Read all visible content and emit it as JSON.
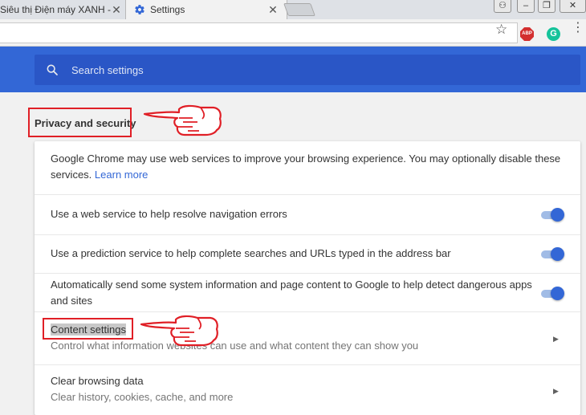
{
  "tabs": [
    {
      "title": "Siêu thị Điện máy XANH - M",
      "close": "✕"
    },
    {
      "title": "Settings",
      "close": "✕"
    }
  ],
  "window_controls": [
    "⚇",
    "–",
    "❐",
    "✕"
  ],
  "toolbar": {
    "star": "☆",
    "abp": "ABP",
    "grammarly": "G",
    "menu": "⋮"
  },
  "search": {
    "placeholder": "Search settings"
  },
  "section": {
    "title": "Privacy and security"
  },
  "intro": {
    "text": "Google Chrome may use web services to improve your browsing experience. You may optionally disable these services.",
    "link": "Learn more"
  },
  "settings": [
    {
      "label": "Use a web service to help resolve navigation errors",
      "enabled": true
    },
    {
      "label": "Use a prediction service to help complete searches and URLs typed in the address bar",
      "enabled": true
    },
    {
      "label": "Automatically send some system information and page content to Google to help detect dangerous apps and sites",
      "enabled": true
    }
  ],
  "content_settings": {
    "title": "Content settings",
    "subtitle": "Control what information websites can use and what content they can show you"
  },
  "clear_data": {
    "title": "Clear browsing data",
    "subtitle": "Clear history, cookies, cache, and more"
  },
  "colors": {
    "accent": "#3367d6",
    "header": "#3367d6",
    "highlight": "#e01f26"
  }
}
